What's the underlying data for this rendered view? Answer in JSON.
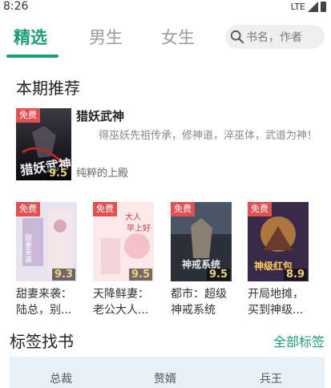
{
  "status_bar": {
    "time": "8:26",
    "network": "LTE"
  },
  "tabs": [
    {
      "label": "精选"
    },
    {
      "label": "男生"
    },
    {
      "label": "女生"
    }
  ],
  "search": {
    "placeholder": "书名，作者"
  },
  "section_recommend": {
    "title": "本期推荐"
  },
  "featured": {
    "badge": "免费",
    "rating": "9.5",
    "title": "猎妖武神",
    "description": "得巫妖先祖传承，修神道，淬巫体，武道为神！",
    "author": "纯粹的上殿"
  },
  "books": [
    {
      "badge": "免费",
      "rating": "9.3",
      "title": "甜妻来袭：陆总，别..."
    },
    {
      "badge": "免费",
      "rating": "9.5",
      "title": "天降鲜妻：老公大人..."
    },
    {
      "badge": "免费",
      "rating": "9.5",
      "title": "都市：超级神戒系统"
    },
    {
      "badge": "免费",
      "rating": "8.9",
      "title": "开局地摊，买到神级..."
    }
  ],
  "section_tags": {
    "title": "标签找书",
    "all_label": "全部标签"
  },
  "tags": [
    "总裁",
    "赘婿",
    "兵王"
  ],
  "colors": {
    "accent": "#1a9e7c",
    "badge": "#e35050",
    "rating": "#f3d27a"
  }
}
